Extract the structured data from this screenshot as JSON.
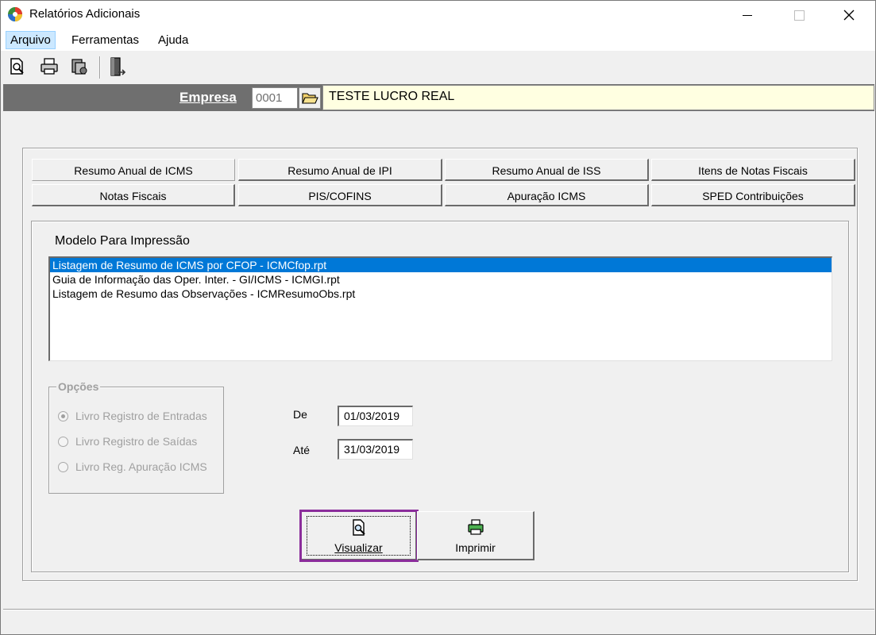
{
  "window": {
    "title": "Relatórios Adicionais",
    "controls": [
      "minimize",
      "maximize",
      "close"
    ]
  },
  "menu": [
    {
      "label": "Arquivo",
      "active": true
    },
    {
      "label": "Ferramentas"
    },
    {
      "label": "Ajuda"
    }
  ],
  "toolbar": {
    "icons": [
      "preview-icon",
      "print-icon",
      "print-setup-icon",
      "exit-icon"
    ]
  },
  "empresa": {
    "label": "Empresa",
    "code": "0001",
    "name": "TESTE LUCRO REAL"
  },
  "tabs": [
    {
      "label": "Resumo Anual de ICMS",
      "selected": true
    },
    {
      "label": "Resumo Anual de IPI"
    },
    {
      "label": "Resumo Anual de ISS"
    },
    {
      "label": "Itens de Notas Fiscais"
    },
    {
      "label": "Notas Fiscais"
    },
    {
      "label": "PIS/COFINS"
    },
    {
      "label": "Apuração ICMS"
    },
    {
      "label": "SPED Contribuições"
    }
  ],
  "modelo": {
    "label": "Modelo Para Impressão",
    "items": [
      "Listagem de Resumo de ICMS por CFOP - ICMCfop.rpt",
      "Guia de Informação das Oper. Inter. - GI/ICMS - ICMGI.rpt",
      "Listagem de Resumo das Observações - ICMResumoObs.rpt"
    ],
    "selected_index": 0
  },
  "opcoes": {
    "label": "Opções",
    "options": [
      {
        "label": "Livro Registro de Entradas",
        "checked": true
      },
      {
        "label": "Livro Registro de Saídas",
        "checked": false
      },
      {
        "label": "Livro Reg. Apuração ICMS",
        "checked": false
      }
    ],
    "enabled": false
  },
  "dates": {
    "de_label": "De",
    "de_value": "01/03/2019",
    "ate_label": "Até",
    "ate_value": "31/03/2019"
  },
  "buttons": {
    "visualizar": "Visualizar",
    "imprimir": "Imprimir"
  },
  "colors": {
    "selection": "#0078d7",
    "empresa_bar": "#6f6f6f",
    "empresa_name_bg": "#ffffe1",
    "focus_outline": "#8b2d9b"
  }
}
